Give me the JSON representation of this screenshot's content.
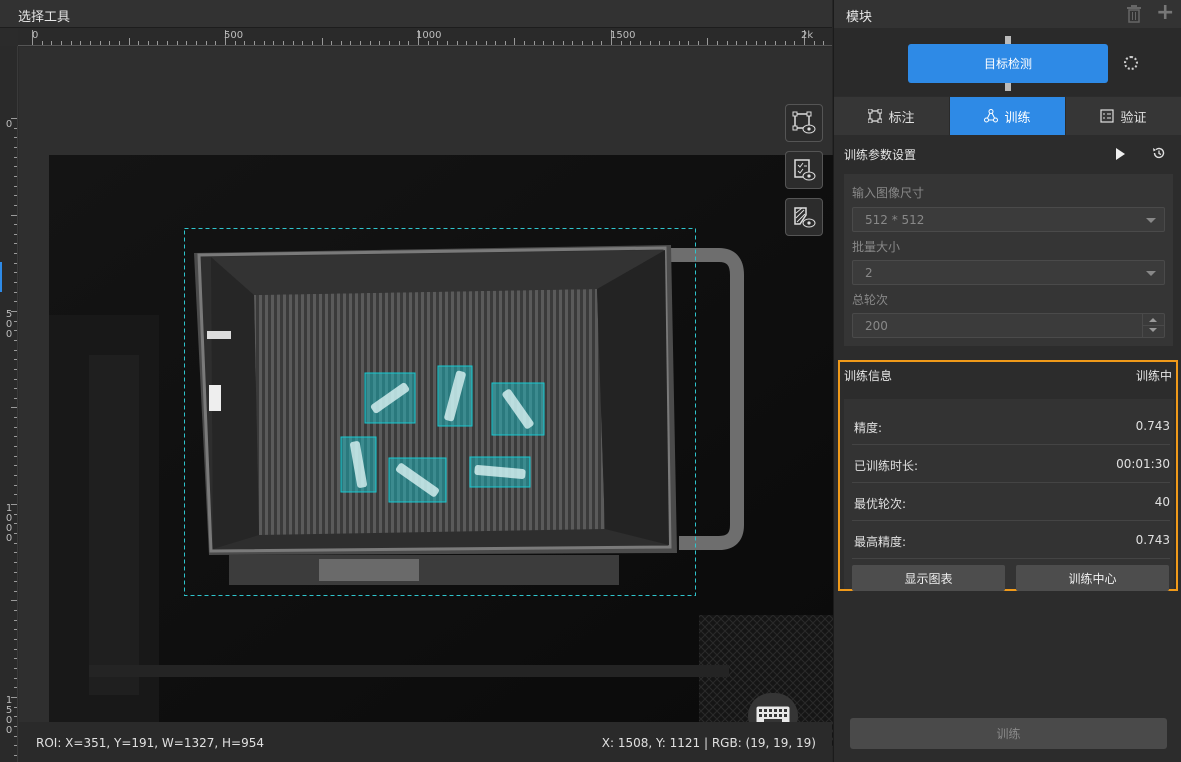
{
  "left_panel": {
    "title": "选择工具",
    "ruler": {
      "h_labels": [
        "0",
        "500",
        "1000",
        "1500",
        "2k"
      ],
      "v_labels": [
        "0",
        "5 0 0",
        "1 0 0 0",
        "1 5 0 0"
      ]
    },
    "tools": {
      "roi_view_icon": "roi-eye-icon",
      "label_view_icon": "checklist-eye-icon",
      "mask_view_icon": "mask-eye-icon"
    },
    "status": {
      "roi": "ROI: X=351, Y=191, W=1327, H=954",
      "pixel": "X: 1508, Y: 1121 | RGB: (19, 19, 19)"
    },
    "colors": {
      "bbox": "#18c8d0",
      "roi_dashed": "#2ec4cc"
    }
  },
  "right_panel": {
    "title": "模块",
    "module_label": "目标检测",
    "tabs": [
      {
        "label": "标注",
        "icon": "annotate-icon",
        "active": false
      },
      {
        "label": "训练",
        "icon": "train-icon",
        "active": true
      },
      {
        "label": "验证",
        "icon": "validate-icon",
        "active": false
      }
    ],
    "params": {
      "title": "训练参数设置",
      "input_size_label": "输入图像尺寸",
      "input_size_value": "512 * 512",
      "batch_size_label": "批量大小",
      "batch_size_value": "2",
      "epochs_label": "总轮次",
      "epochs_value": "200"
    },
    "info": {
      "title": "训练信息",
      "status": "训练中",
      "rows": [
        {
          "label": "精度:",
          "value": "0.743"
        },
        {
          "label": "已训练时长:",
          "value": "00:01:30"
        },
        {
          "label": "最优轮次:",
          "value": "40"
        },
        {
          "label": "最高精度:",
          "value": "0.743"
        }
      ],
      "show_chart_label": "显示图表",
      "training_center_label": "训练中心"
    },
    "train_button_label": "训练",
    "colors": {
      "accent": "#2e8ae6",
      "highlight_border": "#f09a1a"
    }
  }
}
